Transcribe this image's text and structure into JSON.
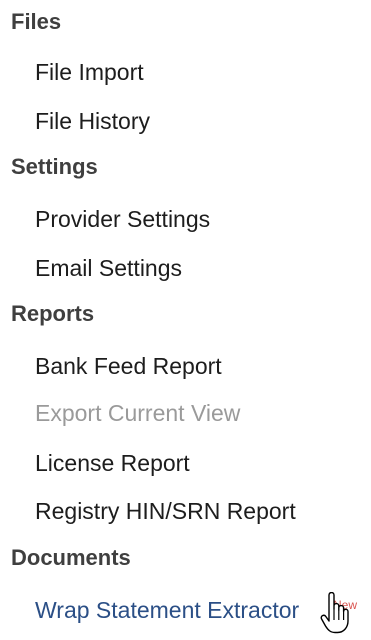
{
  "sections": [
    {
      "heading": "Files",
      "items": [
        "File Import",
        "File History"
      ]
    },
    {
      "heading": "Settings",
      "items": [
        "Provider Settings",
        "Email Settings"
      ]
    },
    {
      "heading": "Reports",
      "items": [
        "Bank Feed Report",
        "Export Current View",
        "License Report",
        "Registry HIN/SRN Report"
      ]
    },
    {
      "heading": "Documents",
      "items": [
        "Wrap Statement Extractor"
      ]
    }
  ],
  "badges": {
    "wrap_statement_new": "New"
  },
  "states": {
    "export_current_view": "disabled",
    "wrap_statement_extractor": "hover"
  },
  "colors": {
    "heading": "#3f3f3f",
    "item": "#1d1d1d",
    "disabled": "#9a9a9a",
    "link_hover": "#2b4f86",
    "badge": "#d9534f"
  },
  "icons": {
    "cursor": "hand-pointer-icon"
  }
}
